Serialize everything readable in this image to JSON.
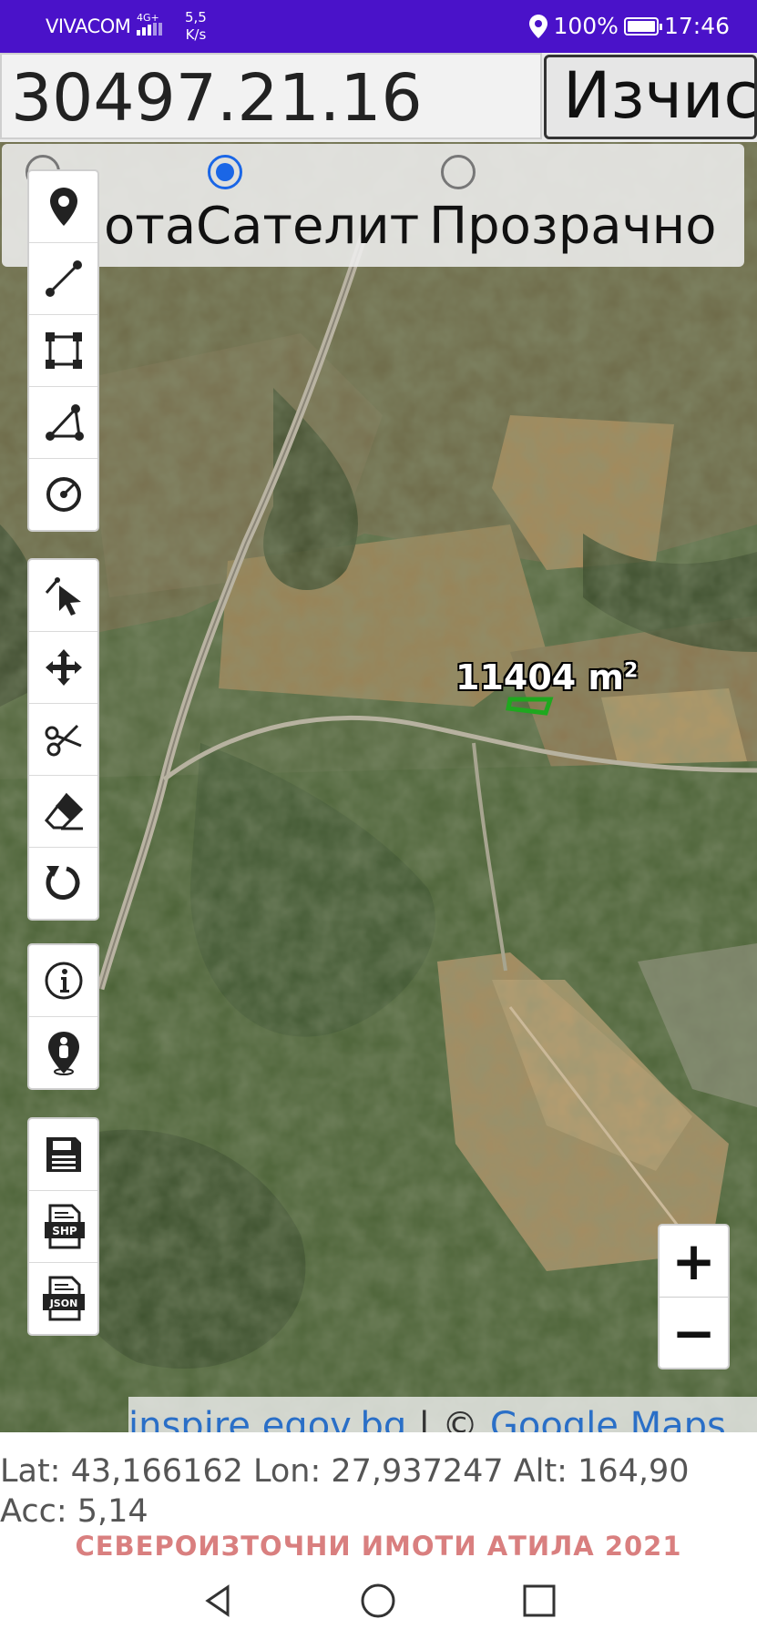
{
  "status_bar": {
    "carrier": "VIVACOM",
    "network_type": "4G+",
    "data_speed_value": "5,5",
    "data_speed_unit": "K/s",
    "battery": "100%",
    "time": "17:46"
  },
  "search": {
    "value": "30497.21.16",
    "calculate_label": "Изчис"
  },
  "layers": {
    "options": [
      "Карта",
      "Сателит",
      "Прозрачно"
    ],
    "visible_map_label": "ота",
    "selected": "Сателит"
  },
  "toolbar": {
    "drawing": [
      "marker-icon",
      "line-icon",
      "polygon-icon",
      "angle-icon",
      "circle-icon"
    ],
    "editing": [
      "select-icon",
      "move-icon",
      "cut-icon",
      "eraser-icon",
      "rotate-icon"
    ],
    "info": [
      "info-icon",
      "location-person-icon"
    ],
    "export": {
      "save": "save-icon",
      "shp_label": "SHP",
      "json_label": "JSON"
    }
  },
  "map": {
    "area_value": "11404 m",
    "area_exponent": "2",
    "attribution_link1": "inspire.egov.bg",
    "attribution_separator": " | © ",
    "attribution_link2": "Google Maps"
  },
  "zoom": {
    "in_label": "+",
    "out_label": "−"
  },
  "coords_text": "Lat: 43,166162 Lon: 27,937247 Alt: 164,90 Acc: 5,14",
  "footer": "СЕВЕРОИЗТОЧНИ ИМОТИ АТИЛА 2021",
  "colors": {
    "status_bar": "#4a12c9",
    "radio_selected": "#1a66e6",
    "footer_text": "#d97f7f",
    "parcel_outline": "#1fa81f"
  }
}
